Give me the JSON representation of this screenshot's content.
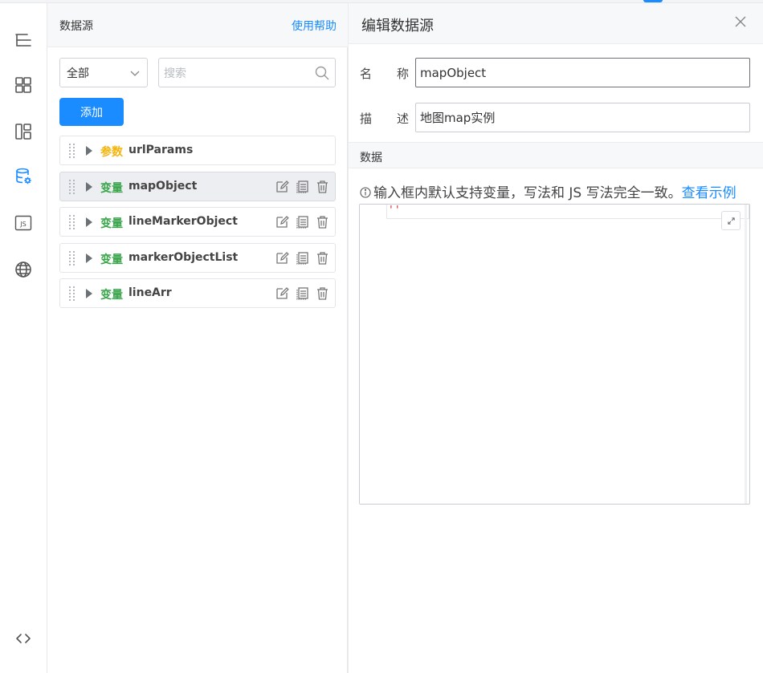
{
  "rail": {
    "items": [
      {
        "icon": "outline-tree-icon"
      },
      {
        "icon": "components-grid-icon"
      },
      {
        "icon": "layout-panel-icon"
      },
      {
        "icon": "datasource-icon",
        "active": true
      },
      {
        "icon": "js-icon"
      },
      {
        "icon": "globe-icon"
      },
      {
        "icon": "code-icon"
      }
    ],
    "js_label": "JS"
  },
  "datasource_panel": {
    "title": "数据源",
    "help": "使用帮助",
    "filter_value": "全部",
    "search_placeholder": "搜索",
    "add_label": "添加",
    "items": [
      {
        "kind": "参数",
        "kind_type": "param",
        "name": "urlParams"
      },
      {
        "kind": "变量",
        "kind_type": "var",
        "name": "mapObject",
        "selected": true
      },
      {
        "kind": "变量",
        "kind_type": "var",
        "name": "lineMarkerObject"
      },
      {
        "kind": "变量",
        "kind_type": "var",
        "name": "markerObjectList"
      },
      {
        "kind": "变量",
        "kind_type": "var",
        "name": "lineArr"
      }
    ]
  },
  "editor": {
    "title": "编辑数据源",
    "name_label_1": "名",
    "name_label_2": "称",
    "name_value": "mapObject",
    "desc_label_1": "描",
    "desc_label_2": "述",
    "desc_value": "地图map实例",
    "data_section": "数据",
    "tip_text": "输入框内默认支持变量，写法和 JS 写法完全一致。",
    "tip_link": "查看示例",
    "code_value": "''"
  },
  "colors": {
    "accent": "#1a8cff",
    "param": "#f2b40b",
    "variable": "#3aa54b"
  }
}
